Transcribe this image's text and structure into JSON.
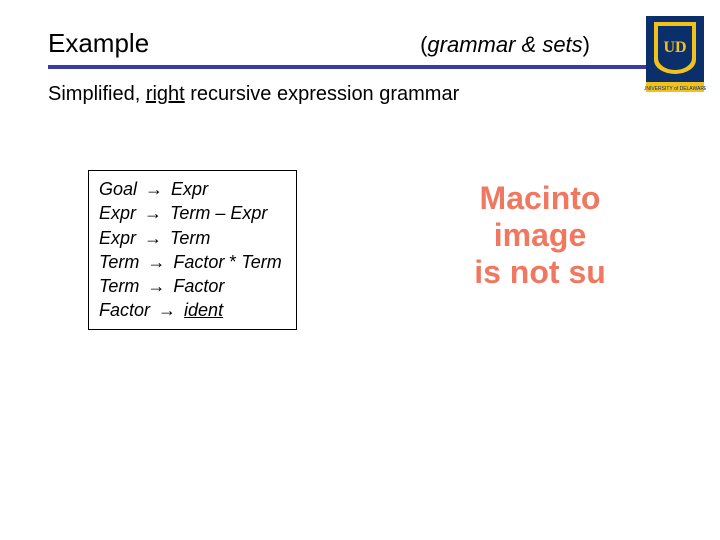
{
  "header": {
    "title": "Example",
    "subtitle_open": "(",
    "subtitle_italic": "grammar & sets",
    "subtitle_close": ")"
  },
  "intro": {
    "prefix": "Simplified, ",
    "underlined": "right",
    "suffix": " recursive expression grammar"
  },
  "grammar": {
    "arrow": "→",
    "rules": [
      {
        "lhs": "Goal",
        "rhs": [
          {
            "t": "Expr"
          }
        ]
      },
      {
        "lhs": "Expr",
        "rhs": [
          {
            "t": "Term"
          },
          {
            "lit": " – "
          },
          {
            "t": "Expr"
          }
        ]
      },
      {
        "lhs": "Expr",
        "rhs": [
          {
            "t": "Term"
          }
        ]
      },
      {
        "lhs": "Term",
        "rhs": [
          {
            "t": "Factor"
          },
          {
            "lit": " * "
          },
          {
            "t": "Term"
          }
        ]
      },
      {
        "lhs": "Term",
        "rhs": [
          {
            "t": "Factor"
          }
        ]
      },
      {
        "lhs": "Factor",
        "rhs": [
          {
            "ident": "ident"
          }
        ]
      }
    ]
  },
  "placeholder": {
    "line1": "Macinto",
    "line2": "image",
    "line3": "is not su"
  },
  "logo": {
    "name": "university-of-delaware-logo",
    "colors": {
      "blue": "#0b2f6b",
      "gold": "#f3c21a"
    }
  }
}
